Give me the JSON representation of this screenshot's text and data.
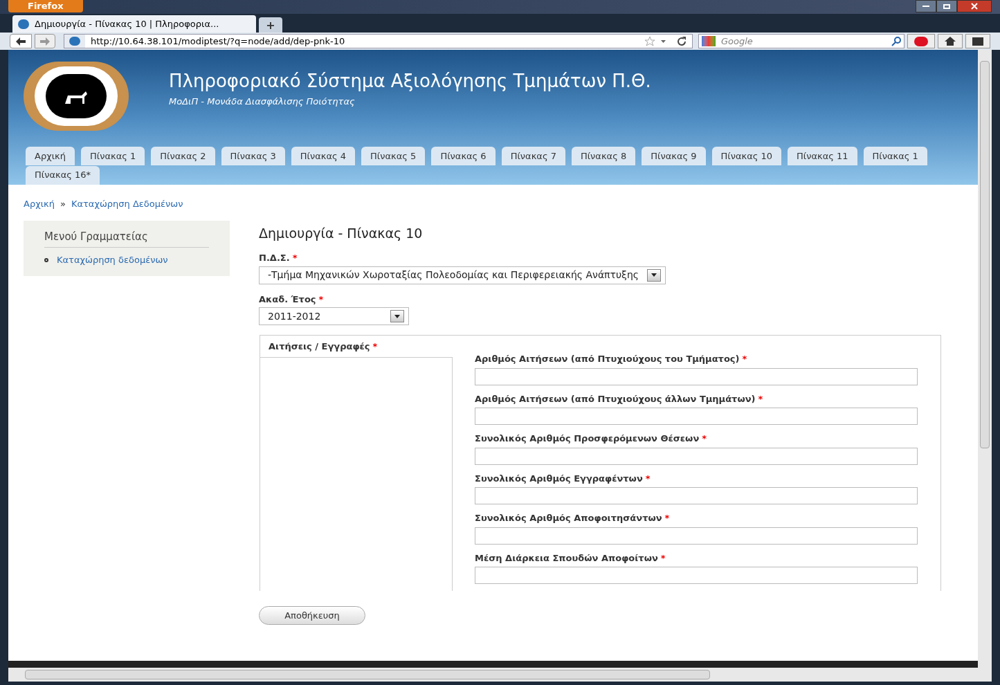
{
  "browser": {
    "app_button": "Firefox",
    "tab_title": "Δημιουργία - Πίνακας 10 | Πληροφορια...",
    "new_tab": "+",
    "url": "http://10.64.38.101/modiptest/?q=node/add/dep-pnk-10",
    "search_placeholder": "Google"
  },
  "header": {
    "title": "Πληροφοριακό Σύστημα Αξιολόγησης Τμημάτων Π.Θ.",
    "subtitle": "ΜοΔιΠ - Μονάδα Διασφάλισης Ποιότητας"
  },
  "nav_tabs": [
    {
      "label": "Αρχική"
    },
    {
      "label": "Πίνακας 1"
    },
    {
      "label": "Πίνακας 2"
    },
    {
      "label": "Πίνακας 3"
    },
    {
      "label": "Πίνακας 4"
    },
    {
      "label": "Πίνακας 5"
    },
    {
      "label": "Πίνακας 6"
    },
    {
      "label": "Πίνακας 7"
    },
    {
      "label": "Πίνακας 8"
    },
    {
      "label": "Πίνακας 9"
    },
    {
      "label": "Πίνακας 10"
    },
    {
      "label": "Πίνακας 11"
    },
    {
      "label": "Πίνακας 1"
    },
    {
      "label": "Πίνακας 16*"
    }
  ],
  "breadcrumb": [
    "Αρχική",
    "Καταχώρηση Δεδομένων"
  ],
  "breadcrumb_separator": "»",
  "sidebar": {
    "title": "Μενού Γραμματείας",
    "items": [
      "Καταχώρηση δεδομένων"
    ]
  },
  "form": {
    "title": "Δημιουργία - Πίνακας 10",
    "selects": [
      {
        "label": "Π.Δ.Σ.",
        "required": true,
        "value": "-Τμήμα Μηχανικών Χωροταξίας Πολεοδομίας και Περιφερειακής Ανάπτυξης"
      },
      {
        "label": "Ακαδ. Έτος",
        "required": true,
        "value": "2011-2012"
      }
    ],
    "group": {
      "tab": "Αιτήσεις / Εγγραφές",
      "required": true,
      "fields": [
        {
          "label": "Αριθμός Αιτήσεων (από Πτυχιούχους του Τμήματος)",
          "required": true
        },
        {
          "label": "Αριθμός Αιτήσεων (από Πτυχιούχους άλλων Τμημάτων)",
          "required": true
        },
        {
          "label": "Συνολικός Αριθμός Προσφερόμενων Θέσεων",
          "required": true
        },
        {
          "label": "Συνολικός Αριθμός Εγγραφέντων",
          "required": true
        },
        {
          "label": "Συνολικός Αριθμός Αποφοιτησάντων",
          "required": true
        },
        {
          "label": "Μέση Διάρκεια Σπουδών Αποφοίτων",
          "required": true
        }
      ]
    },
    "required_mark": "*",
    "save": "Αποθήκευση"
  }
}
